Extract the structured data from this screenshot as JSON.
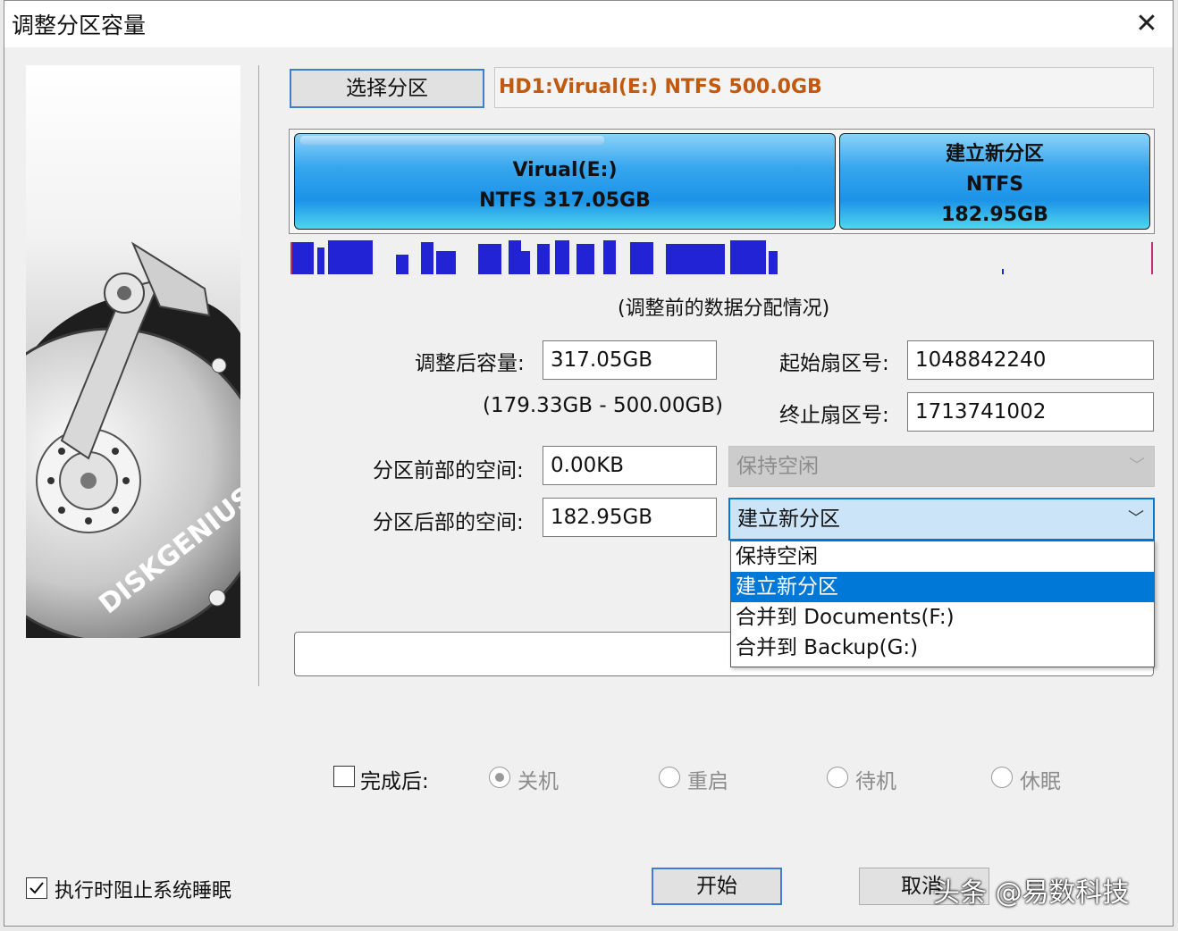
{
  "window": {
    "title": "调整分区容量",
    "close_label": "✕"
  },
  "sidebar": {
    "brand": "DISKGENIUS"
  },
  "select_partition": {
    "button_label": "选择分区",
    "info": "HD1:Virual(E:) NTFS 500.0GB"
  },
  "disk_map": {
    "partitions": [
      {
        "line1": "Virual(E:)",
        "line2": "NTFS 317.05GB"
      },
      {
        "line1": "建立新分区",
        "line2": "NTFS",
        "line3": "182.95GB"
      }
    ],
    "caption": "(调整前的数据分配情况)"
  },
  "form": {
    "size_after_label": "调整后容量:",
    "size_after_value": "317.05GB",
    "size_range": "(179.33GB - 500.00GB)",
    "start_sector_label": "起始扇区号:",
    "start_sector_value": "1048842240",
    "end_sector_label": "终止扇区号:",
    "end_sector_value": "1713741002",
    "space_before_label": "分区前部的空间:",
    "space_before_value": "0.00KB",
    "space_before_action": "保持空闲",
    "space_after_label": "分区后部的空间:",
    "space_after_value": "182.95GB",
    "space_after_action": "建立新分区",
    "dropdown_options": [
      "保持空闲",
      "建立新分区",
      "合并到 Documents(F:)",
      "合并到 Backup(G:)"
    ],
    "dropdown_selected": 1
  },
  "after_complete": {
    "checkbox_label": "完成后:",
    "options": [
      "关机",
      "重启",
      "待机",
      "休眠"
    ]
  },
  "footer": {
    "prevent_sleep_label": "执行时阻止系统睡眠",
    "start_label": "开始",
    "cancel_label": "取消",
    "watermark": "头条 @易数科技"
  },
  "colors": {
    "accent": "#0078d7",
    "partition_info_text": "#c05a10",
    "usage_bar": "#2323d6"
  }
}
